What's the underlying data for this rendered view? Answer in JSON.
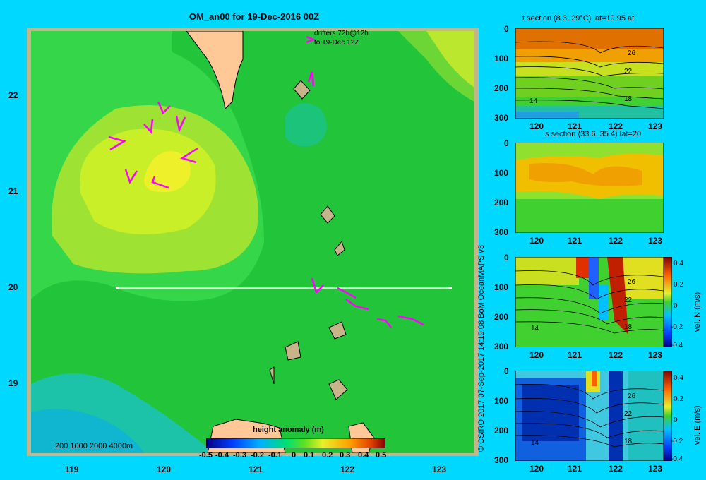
{
  "map": {
    "title": "OM_an00 for 19-Dec-2016 00Z",
    "drifters_line1": "drifters 72h@12h",
    "drifters_line2": "to 19-Dec 12Z",
    "depth_legend": "200  1000  2000  4000m",
    "x_ticks": [
      "119",
      "120",
      "121",
      "122",
      "123"
    ],
    "y_ticks": [
      "22",
      "21",
      "20",
      "19"
    ],
    "colorbar_title": "height anomaly (m)",
    "colorbar_ticks": [
      "-0.5",
      "-0.4",
      "-0.3",
      "-0.2",
      "-0.1",
      "0",
      "0.1",
      "0.2",
      "0.3",
      "0.4",
      "0.5"
    ]
  },
  "copyright": "© CSIRO 2017   07-Sep-2017 14:19:08 BoM OceanMAPS v3",
  "panels": [
    {
      "title": "t section (8.3..29°C) lat=19.95 at",
      "y_ticks": [
        "0",
        "100",
        "200",
        "300"
      ],
      "x_ticks": [
        "120",
        "121",
        "122",
        "123"
      ],
      "contour_labels": [
        "26",
        "22",
        "18",
        "14"
      ],
      "has_colorbar": false
    },
    {
      "title": "s section (33.6..35.4) lat=20",
      "y_ticks": [
        "0",
        "100",
        "200",
        "300"
      ],
      "x_ticks": [
        "120",
        "121",
        "122",
        "123"
      ],
      "contour_labels": [],
      "has_colorbar": false
    },
    {
      "title": "",
      "y_ticks": [
        "0",
        "100",
        "200",
        "300"
      ],
      "x_ticks": [
        "120",
        "121",
        "122",
        "123"
      ],
      "contour_labels": [
        "26",
        "22",
        "18",
        "14"
      ],
      "has_colorbar": true,
      "cb_ticks": [
        "0.4",
        "0.2",
        "0",
        "-0.2",
        "-0.4"
      ],
      "cb_label": "vel. N (m/s)"
    },
    {
      "title": "",
      "y_ticks": [
        "0",
        "100",
        "200",
        "300"
      ],
      "x_ticks": [
        "120",
        "121",
        "122",
        "123"
      ],
      "contour_labels": [
        "26",
        "22",
        "18",
        "14"
      ],
      "has_colorbar": true,
      "cb_ticks": [
        "0.4",
        "0.2",
        "0",
        "-0.2",
        "-0.4"
      ],
      "cb_label": "vel. E (m/s)"
    }
  ],
  "colors": {
    "background": "#00d8ff",
    "land": "#ffc896",
    "drifter": "#ff00ff",
    "section_line": "#ffffff"
  },
  "icons": [
    "drifter-arrow-icon"
  ]
}
